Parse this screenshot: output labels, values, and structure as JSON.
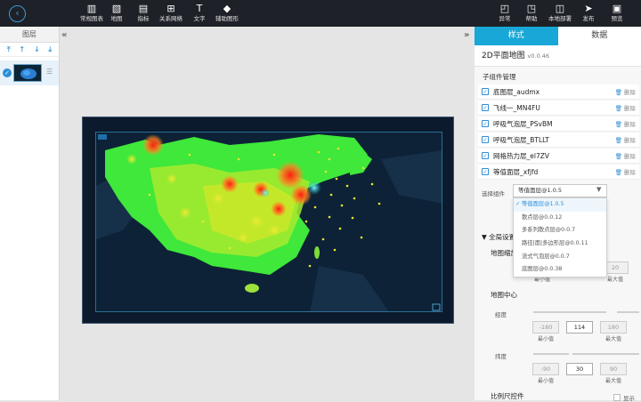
{
  "toolbar": {
    "back_icon": "back-arrow-icon",
    "items": [
      {
        "label": "常规图表",
        "icon": "bar-chart-icon"
      },
      {
        "label": "地图",
        "icon": "map-icon"
      },
      {
        "label": "指标",
        "icon": "indicator-icon"
      },
      {
        "label": "关系网络",
        "icon": "network-icon"
      },
      {
        "label": "文字",
        "icon": "text-icon"
      },
      {
        "label": "辅助图形",
        "icon": "shapes-icon"
      }
    ],
    "right_items": [
      {
        "label": "异常",
        "icon": "alert-icon"
      },
      {
        "label": "帮助",
        "icon": "help-icon"
      },
      {
        "label": "本地部署",
        "icon": "deploy-icon"
      },
      {
        "label": "发布",
        "icon": "publish-icon"
      },
      {
        "label": "预览",
        "icon": "preview-icon"
      }
    ]
  },
  "layers": {
    "title": "图层",
    "tool_icons": [
      "move-top-icon",
      "move-up-icon",
      "move-down-icon",
      "move-bottom-icon"
    ]
  },
  "right_panel": {
    "tabs": [
      "样式",
      "数据"
    ],
    "active_tab": "样式",
    "component_name": "2D平面地图",
    "component_version": "v0.0.46",
    "sub_components_title": "子组件管理",
    "delete_label": "删除",
    "sub_components": [
      "底图层_audmx",
      "飞线一_MN4FU",
      "呼吸气泡层_PSvBM",
      "呼吸气泡层_BTLLT",
      "网格热力层_el7ZV",
      "等值面层_xfjfd"
    ],
    "select_label": "选择组件",
    "select_value": "等值面层@1.0.5",
    "options": [
      "等值面层@1.0.5",
      "散点层@0.0.12",
      "多系列散点层@0.0.7",
      "路径|面|多边形层@0.0.11",
      "流式气泡层@0.0.7",
      "底图层@0.0.38"
    ],
    "global_settings": "全局设置",
    "zoom_label": "地图缩放",
    "zoom_max_value": "20",
    "center_label": "地图中心",
    "lng_label": "经度",
    "lng": {
      "min": "-180",
      "value": "114",
      "max": "180"
    },
    "lat_label": "纬度",
    "lat": {
      "min": "-90",
      "value": "30",
      "max": "90"
    },
    "min_caption": "最小值",
    "max_caption": "最大值",
    "scale_label": "比例尺控件",
    "show_label": "显示"
  },
  "colors": {
    "topbar": "#1e2127",
    "accent": "#18a7d6",
    "map_bg": "#0d2236",
    "heat_low": "#22d43a",
    "heat_mid": "#c8e82a",
    "heat_high": "#ff2a1a"
  }
}
